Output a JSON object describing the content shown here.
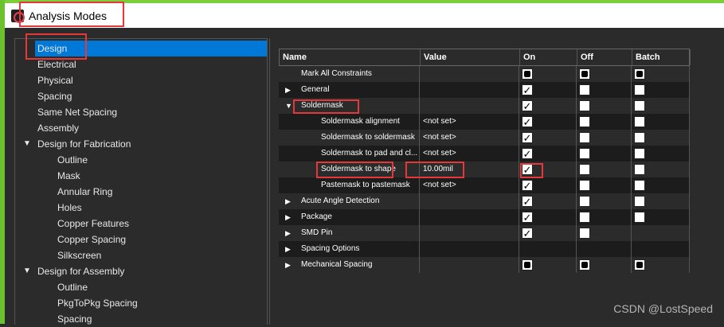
{
  "window": {
    "title": "Analysis Modes"
  },
  "tree": {
    "items": [
      {
        "label": "Design",
        "level": 0,
        "selected": true
      },
      {
        "label": "Electrical",
        "level": 0
      },
      {
        "label": "Physical",
        "level": 0
      },
      {
        "label": "Spacing",
        "level": 0
      },
      {
        "label": "Same Net Spacing",
        "level": 0
      },
      {
        "label": "Assembly",
        "level": 0
      },
      {
        "label": "Design for Fabrication",
        "level": 0,
        "expanded": true
      },
      {
        "label": "Outline",
        "level": 1
      },
      {
        "label": "Mask",
        "level": 1
      },
      {
        "label": "Annular Ring",
        "level": 1
      },
      {
        "label": "Holes",
        "level": 1
      },
      {
        "label": "Copper Features",
        "level": 1
      },
      {
        "label": "Copper Spacing",
        "level": 1
      },
      {
        "label": "Silkscreen",
        "level": 1
      },
      {
        "label": "Design for Assembly",
        "level": 0,
        "expanded": true
      },
      {
        "label": "Outline",
        "level": 1
      },
      {
        "label": "PkgToPkg Spacing",
        "level": 1
      },
      {
        "label": "Spacing",
        "level": 1
      }
    ]
  },
  "table": {
    "headers": [
      "Name",
      "Value",
      "On",
      "Off",
      "Batch"
    ],
    "rows": [
      {
        "name": "Mark All Constraints",
        "value": "",
        "level": 0,
        "toggle": "",
        "on": "mixed",
        "off": "mixed",
        "batch": "mixed"
      },
      {
        "name": "General",
        "value": "",
        "level": 0,
        "toggle": "collapsed",
        "on": "checked",
        "off": "unchecked",
        "batch": "unchecked"
      },
      {
        "name": "Soldermask",
        "value": "",
        "level": 0,
        "toggle": "expanded",
        "on": "checked",
        "off": "unchecked",
        "batch": "unchecked"
      },
      {
        "name": "Soldermask alignment",
        "value": "<not set>",
        "level": 1,
        "toggle": "",
        "on": "checked",
        "off": "unchecked",
        "batch": "unchecked"
      },
      {
        "name": "Soldermask to soldermask",
        "value": "<not set>",
        "level": 1,
        "toggle": "",
        "on": "checked",
        "off": "unchecked",
        "batch": "unchecked"
      },
      {
        "name": "Soldermask to pad and cl...",
        "value": "<not set>",
        "level": 1,
        "toggle": "",
        "on": "checked",
        "off": "unchecked",
        "batch": "unchecked"
      },
      {
        "name": "Soldermask to shape",
        "value": "10.00mil",
        "level": 1,
        "toggle": "",
        "on": "checked",
        "off": "unchecked",
        "batch": "unchecked"
      },
      {
        "name": "Pastemask to pastemask",
        "value": "<not set>",
        "level": 1,
        "toggle": "",
        "on": "checked",
        "off": "unchecked",
        "batch": "unchecked"
      },
      {
        "name": "Acute Angle Detection",
        "value": "",
        "level": 0,
        "toggle": "collapsed",
        "on": "checked",
        "off": "unchecked",
        "batch": "unchecked"
      },
      {
        "name": "Package",
        "value": "",
        "level": 0,
        "toggle": "collapsed",
        "on": "checked",
        "off": "unchecked",
        "batch": "unchecked"
      },
      {
        "name": "SMD Pin",
        "value": "",
        "level": 0,
        "toggle": "collapsed",
        "on": "checked",
        "off": "unchecked",
        "batch": "none"
      },
      {
        "name": "Spacing Options",
        "value": "",
        "level": 0,
        "toggle": "collapsed",
        "on": "none",
        "off": "none",
        "batch": "none"
      },
      {
        "name": "Mechanical Spacing",
        "value": "",
        "level": 0,
        "toggle": "collapsed",
        "on": "mixed",
        "off": "mixed",
        "batch": "mixed"
      }
    ]
  },
  "icons": {
    "collapsed": "▶",
    "expanded": "▼",
    "check": "✓"
  },
  "watermark": "CSDN @LostSpeed",
  "colors": {
    "selection": "#0078d7",
    "highlight": "#e5383b",
    "background": "#2b2b2b"
  }
}
